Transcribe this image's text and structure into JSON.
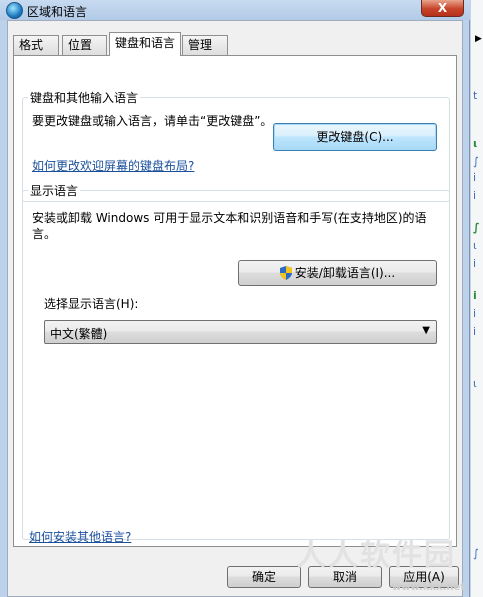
{
  "window": {
    "title": "区域和语言",
    "close_label": "X"
  },
  "tabs": [
    {
      "label": "格式"
    },
    {
      "label": "位置"
    },
    {
      "label": "键盘和语言",
      "active": true
    },
    {
      "label": "管理"
    }
  ],
  "keyboard_group": {
    "legend": "键盘和其他输入语言",
    "description": "要更改键盘或输入语言，请单击“更改键盘”。",
    "change_keyboard_button": "更改键盘(C)...",
    "welcome_link": "如何更改欢迎屏幕的键盘布局?"
  },
  "display_group": {
    "legend": "显示语言",
    "description": "安装或卸载 Windows 可用于显示文本和识别语音和手写(在支持地区)的语言。",
    "install_button": "安装/卸载语言(I)...",
    "select_label": "选择显示语言(H):",
    "select_value": "中文(繁體)"
  },
  "footer_link": "如何安装其他语言?",
  "buttons": {
    "ok": "确定",
    "cancel": "取消",
    "apply": "应用(A)"
  },
  "watermark": {
    "text": "人人软件园",
    "url": "www.kkx.net"
  },
  "background_fragments": [
    "▶",
    "t",
    "ι",
    "∫",
    "і",
    "i",
    "∫",
    "ι",
    "i",
    "i",
    "i",
    "i",
    "ι",
    "∫"
  ]
}
